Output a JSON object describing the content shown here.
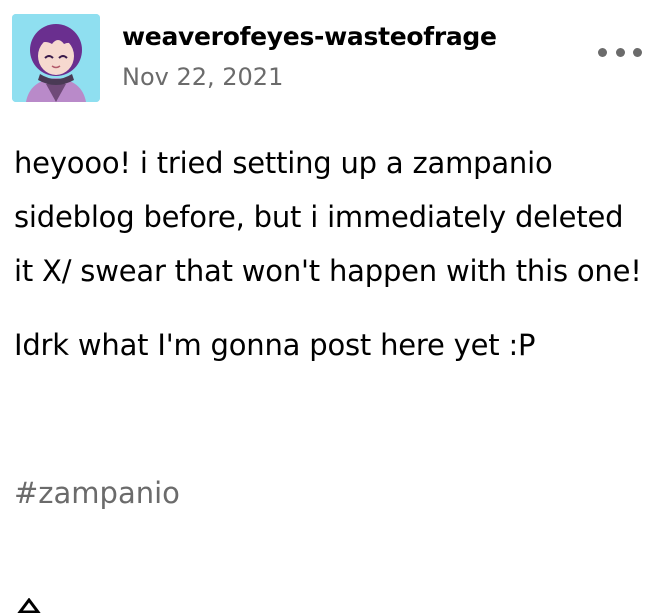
{
  "post": {
    "author": {
      "username": "weaverofeyes-wastеofrage",
      "avatar_icon": "avatar-image"
    },
    "date": "Nov 22, 2021",
    "menu_icon": "more-options-icon",
    "paragraphs": [
      "heyooo! i tried setting up a zampanio sideblog before, but i immediately deleted it X/ swear that won't happen with this one!",
      "Idrk what I'm gonna post here yet :P"
    ],
    "tags": [
      "#zampanio"
    ]
  },
  "colors": {
    "text": "#000000",
    "secondary_text": "#6b6b6b",
    "avatar_background": "#8fdff0"
  }
}
